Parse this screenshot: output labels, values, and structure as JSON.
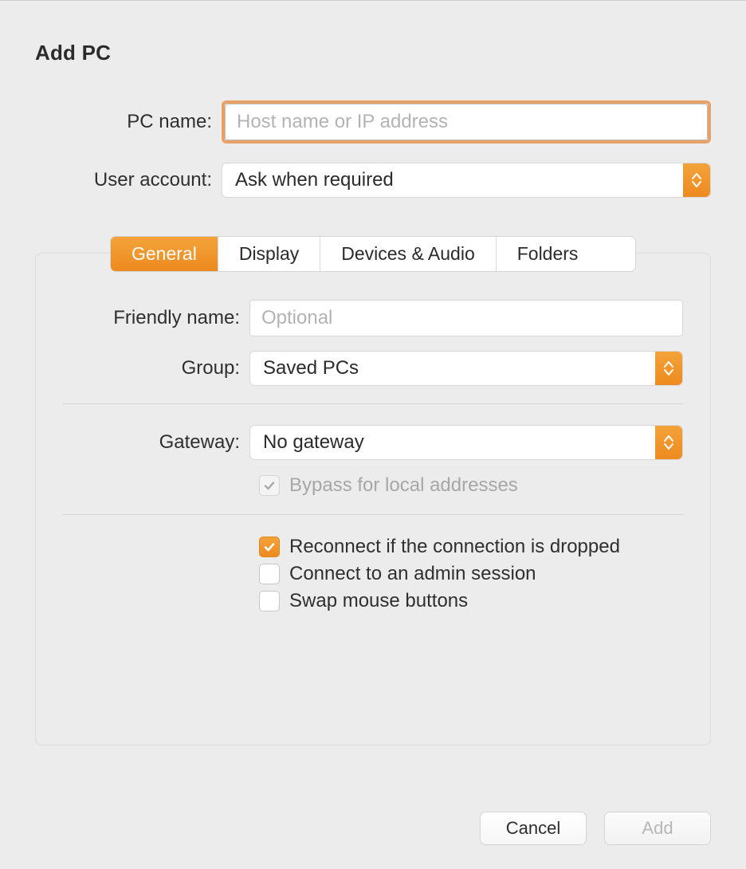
{
  "title": "Add PC",
  "fields": {
    "pc_name": {
      "label": "PC name:",
      "placeholder": "Host name or IP address",
      "value": ""
    },
    "user_account": {
      "label": "User account:",
      "value": "Ask when required"
    }
  },
  "tabs": {
    "general": "General",
    "display": "Display",
    "devices_audio": "Devices & Audio",
    "folders": "Folders",
    "active": "general"
  },
  "general_panel": {
    "friendly_name": {
      "label": "Friendly name:",
      "placeholder": "Optional",
      "value": ""
    },
    "group": {
      "label": "Group:",
      "value": "Saved PCs"
    },
    "gateway": {
      "label": "Gateway:",
      "value": "No gateway"
    },
    "bypass_local": {
      "label": "Bypass for local addresses",
      "checked": true,
      "enabled": false
    },
    "reconnect": {
      "label": "Reconnect if the connection is dropped",
      "checked": true
    },
    "admin_session": {
      "label": "Connect to an admin session",
      "checked": false
    },
    "swap_mouse": {
      "label": "Swap mouse buttons",
      "checked": false
    }
  },
  "buttons": {
    "cancel": "Cancel",
    "add": "Add",
    "add_enabled": false
  }
}
